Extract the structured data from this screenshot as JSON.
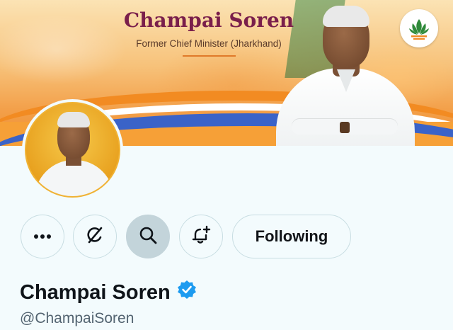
{
  "banner": {
    "title": "Champai Soren",
    "subtitle": "Former Chief Minister (Jharkhand)",
    "logo_icon": "lotus-icon"
  },
  "profile": {
    "display_name": "Champai Soren",
    "handle": "@ChampaiSoren",
    "verified": true,
    "verified_icon": "verified-badge-icon",
    "verified_color": "#1d9bf0"
  },
  "actions": {
    "more_icon": "more-icon",
    "grok_icon": "grok-icon",
    "search_icon": "search-icon",
    "notify_icon": "bell-plus-icon",
    "follow_label": "Following"
  },
  "colors": {
    "banner_orange": "#f3a04a",
    "banner_blue": "#3a63c8",
    "title_maroon": "#7a1f4b",
    "page_bg": "#f3fbfd",
    "handle_gray": "#536471"
  }
}
